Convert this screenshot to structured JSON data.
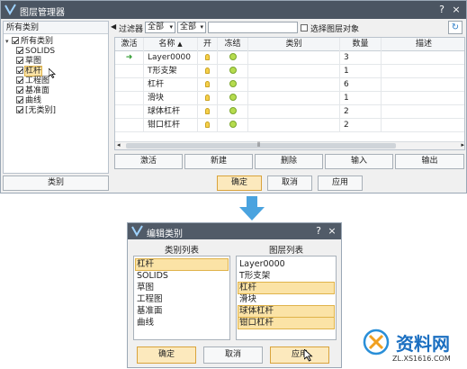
{
  "layer_manager": {
    "title": "图层管理器",
    "tree_header": "所有类别",
    "tree": [
      {
        "label": "所有类别",
        "checked": true,
        "level": 0
      },
      {
        "label": "SOLIDS",
        "checked": true,
        "level": 1
      },
      {
        "label": "草图",
        "checked": true,
        "level": 1
      },
      {
        "label": "杠杆",
        "checked": true,
        "level": 1
      },
      {
        "label": "工程图",
        "checked": true,
        "level": 1
      },
      {
        "label": "基准面",
        "checked": true,
        "level": 1
      },
      {
        "label": "曲线",
        "checked": true,
        "level": 1
      },
      {
        "label": "[无类别]",
        "checked": true,
        "level": 1
      }
    ],
    "filter_label": "过滤器",
    "filter_value_1": "全部",
    "filter_value_2": "全部",
    "search_placeholder": "",
    "select_layer_objects_label": "选择图层对象",
    "columns": [
      "激活",
      "名称",
      "开",
      "冻结",
      "类别",
      "数量",
      "描述"
    ],
    "rows": [
      {
        "name": "Layer0000",
        "count": "3",
        "active": true
      },
      {
        "name": "T形支架",
        "count": "1",
        "active": false
      },
      {
        "name": "杠杆",
        "count": "6",
        "active": false
      },
      {
        "name": "滑块",
        "count": "1",
        "active": false
      },
      {
        "name": "球体杠杆",
        "count": "2",
        "active": false
      },
      {
        "name": "钳口杠杆",
        "count": "2",
        "active": false
      }
    ],
    "buttons": {
      "activate": "激活",
      "new": "新建",
      "delete": "删除",
      "import": "输入",
      "export": "输出",
      "category": "类别",
      "ok": "确定",
      "cancel": "取消",
      "apply": "应用"
    }
  },
  "edit_category": {
    "title": "编辑类别",
    "category_list_header": "类别列表",
    "layer_list_header": "图层列表",
    "categories": [
      "杠杆",
      "SOLIDS",
      "草图",
      "工程图",
      "基准面",
      "曲线"
    ],
    "categories_selected": [
      true,
      false,
      false,
      false,
      false,
      false
    ],
    "layers": [
      "Layer0000",
      "T形支架",
      "杠杆",
      "滑块",
      "球体杠杆",
      "钳口杠杆"
    ],
    "layers_selected": [
      false,
      false,
      true,
      false,
      true,
      true
    ],
    "buttons": {
      "ok": "确定",
      "cancel": "取消",
      "apply": "应用"
    }
  },
  "watermark": {
    "text": "资料网",
    "url": "ZL.XS1616.COM"
  },
  "colors": {
    "accent_arrow": "#4aa3df",
    "highlight": "#fbe3a6",
    "titlebar": "#4b5562"
  }
}
